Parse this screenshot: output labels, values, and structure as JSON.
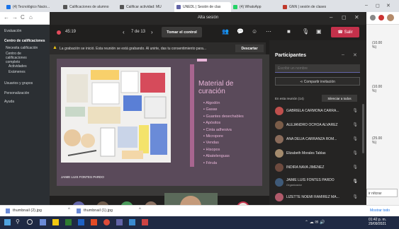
{
  "browser": {
    "tabs": [
      "(4) Tecnológico Nacio...",
      "Calificaciones de alumno",
      "Calificar actividad: MU",
      "UNEDL | Sesión de clas",
      "(4) WhatsApp",
      "GNN | sesión de clases"
    ],
    "url": "",
    "window_controls": [
      "–",
      "◻",
      "✕"
    ]
  },
  "lms": {
    "items": [
      "Evaluación",
      "Centro de calificaciones",
      "Necesita calificación",
      "Centro de calificaciones completo",
      "Actividades",
      "Exámenes",
      "Usuarios y grupos",
      "Personalización",
      "Ayuda"
    ],
    "grades": [
      "(10.00\n%)",
      "(10.00\n%)",
      "(25.00\n%)"
    ],
    "right_button": "ir nítcrar"
  },
  "teams": {
    "title": "Alta sesión",
    "timer": "45:19",
    "page": "7 de 13",
    "take_control": "Tomar el control",
    "leave": "Salir",
    "notice": "La grabación se inició. Esta reunión se está grabando. Al unirte, das tu consentimiento para...",
    "dismiss": "Descartar",
    "presenter_name": "JAIME LUIS FONTES PARDO",
    "slide": {
      "title": "Material de curación",
      "bullets": [
        "Algodón",
        "Gasas",
        "Guantes desechables",
        "Apósitos",
        "Cinta adhesiva",
        "Micropore",
        "Vendas",
        "Hisopos",
        "Abatelenguas",
        "Férula"
      ]
    },
    "participants": {
      "header": "Participantes",
      "search_placeholder": "Escribir un nombre",
      "share": "Compartir invitación",
      "in_meeting": "En esta reunión (14)",
      "mute_all": "Silenciar a todos",
      "list": [
        {
          "name": "GABRIELA CARMONA CARRA...",
          "color": "#c0504d"
        },
        {
          "name": "ALEJANDRO OCHOA ALVAREZ",
          "color": "#7a5c48"
        },
        {
          "name": "ANA DELIA CARRANZA ROM...",
          "color": "#8a6b5a"
        },
        {
          "name": "Elizabeth Morales Tablas",
          "color": "#a48b6d"
        },
        {
          "name": "INDIRA NAVA JIMENEZ",
          "color": "#6d4a3e"
        },
        {
          "name": "JAIME LUIS FONTES PARDO",
          "role": "Organizador",
          "color": "#3f5a78"
        },
        {
          "name": "LIZETTE NOEMI RAMIREZ MA...",
          "color": "#b05a6a"
        }
      ]
    },
    "bottom": {
      "count": "+9",
      "og": "OG",
      "video_name": "JAIME LUIS FONTES PARDO"
    }
  },
  "downloads": {
    "files": [
      "thumbnail (2).jpg",
      "thumbnail (1).jpg"
    ],
    "show_all": "Mostrar todo"
  },
  "taskbar": {
    "time": "01:42 p. m.",
    "date": "29/09/2021"
  },
  "colors": {
    "leave": "#c4314b",
    "accent": "#6264a7",
    "slide_bg": "#5a4a5a",
    "title_pink": "#e8b5d8"
  }
}
